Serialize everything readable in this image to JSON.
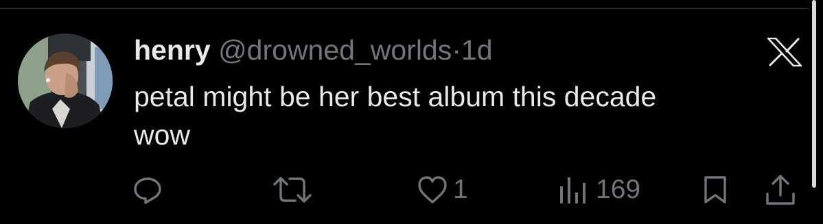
{
  "tweet": {
    "author_name": "henry",
    "handle": "@drowned_worlds",
    "separator": "·",
    "timestamp": "1d",
    "text": "petal might be her best album this decade\nwow"
  },
  "actions": {
    "reply": {
      "icon": "reply-icon"
    },
    "retweet": {
      "icon": "retweet-icon"
    },
    "like": {
      "icon": "heart-icon",
      "count": "1"
    },
    "views": {
      "icon": "views-icon",
      "count": "169"
    },
    "bookmark": {
      "icon": "bookmark-icon"
    },
    "share": {
      "icon": "share-icon"
    }
  },
  "colors": {
    "background": "#000000",
    "primary_text": "#e7e9ea",
    "secondary_text": "#71767b",
    "divider": "#2f3336"
  }
}
